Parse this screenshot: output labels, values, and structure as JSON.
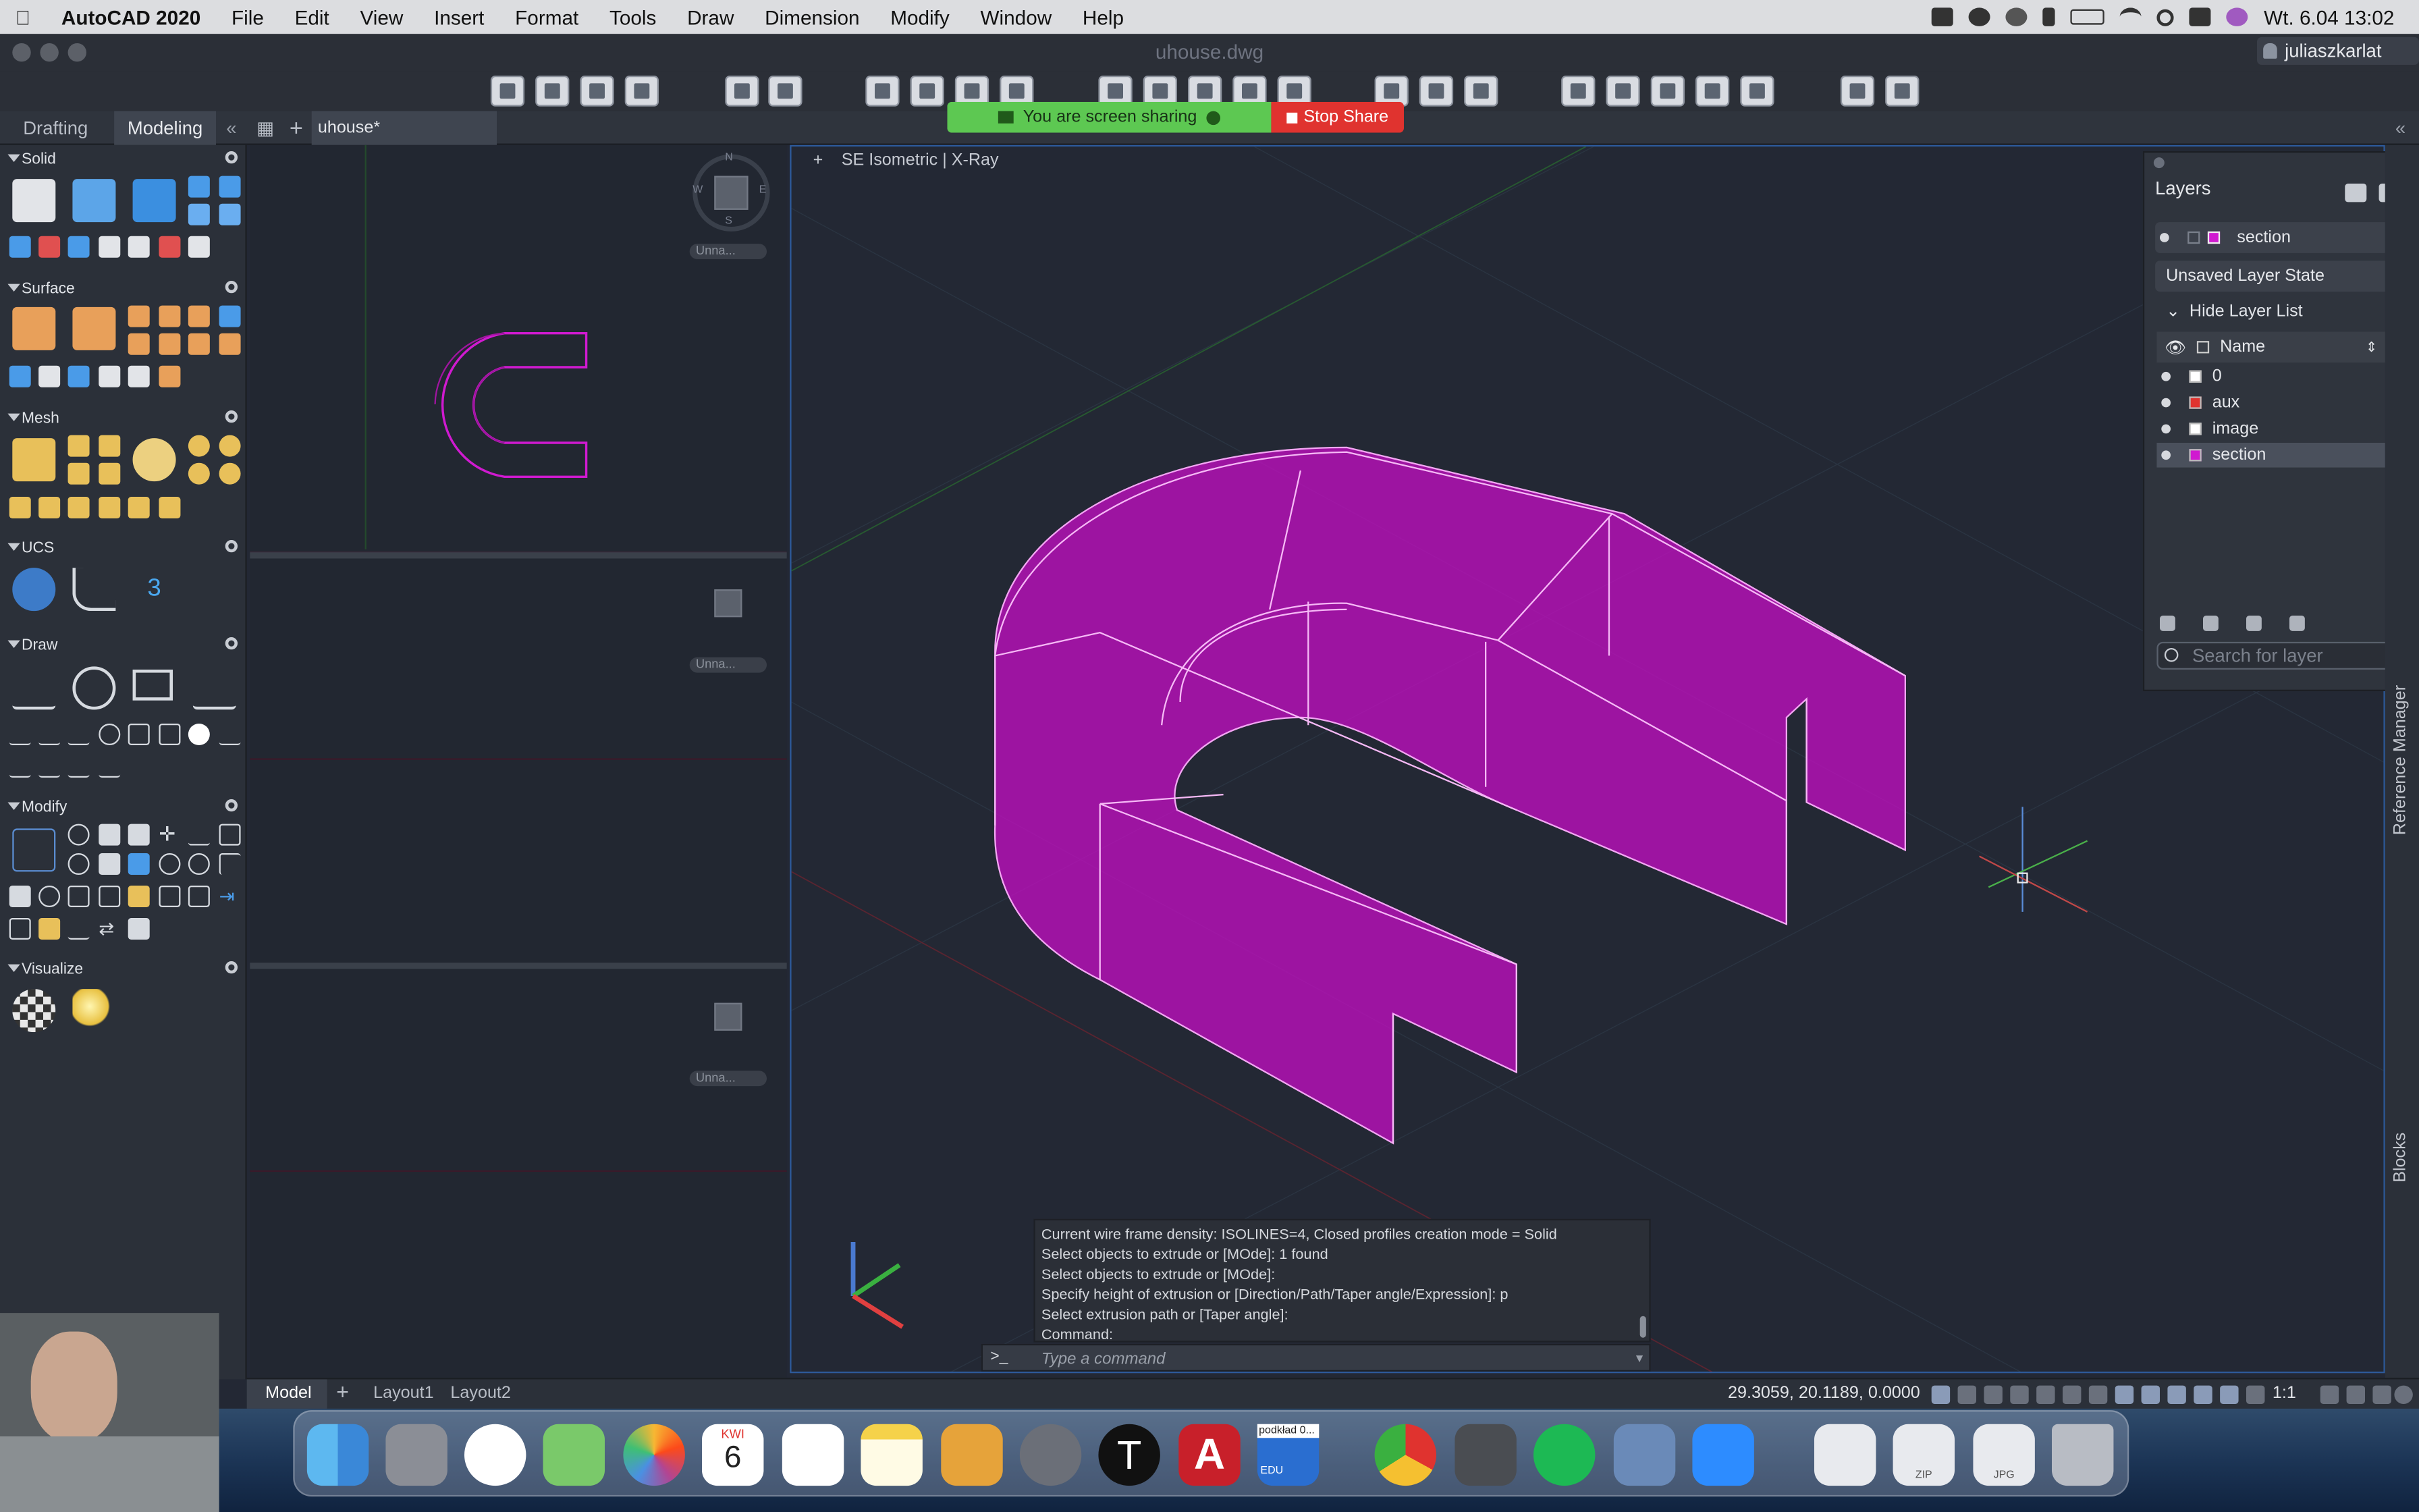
{
  "menubar": {
    "app_name": "AutoCAD 2020",
    "items": [
      "File",
      "Edit",
      "View",
      "Insert",
      "Format",
      "Tools",
      "Draw",
      "Dimension",
      "Modify",
      "Window",
      "Help"
    ],
    "clock": "Wt. 6.04  13:02"
  },
  "window": {
    "title": "uhouse.dwg",
    "user": "juliaszkarlat"
  },
  "share_banner": {
    "message": "You are screen sharing",
    "stop_label": "Stop Share"
  },
  "palette_tabs": {
    "drafting": "Drafting",
    "modeling": "Modeling"
  },
  "doc_tab": {
    "label": "uhouse*"
  },
  "tool_palette": {
    "sections": [
      "Solid",
      "Surface",
      "Mesh",
      "UCS",
      "Draw",
      "Modify",
      "Visualize"
    ]
  },
  "viewports": {
    "main_label": "SE Isometric | X-Ray",
    "compass": {
      "n": "N",
      "s": "S",
      "w": "W",
      "e": "E"
    },
    "small_label": "Unna..."
  },
  "ucs_badge": "3",
  "layers_panel": {
    "title": "Layers",
    "current_layer": "section",
    "layer_state": "Unsaved Layer State",
    "hide_list_label": "Hide Layer List",
    "column_name": "Name",
    "layers": [
      {
        "name": "0",
        "color": "#ffffff"
      },
      {
        "name": "aux",
        "color": "#e0332f"
      },
      {
        "name": "image",
        "color": "#ffffff"
      },
      {
        "name": "section",
        "color": "#d01ad0"
      }
    ],
    "search_placeholder": "Search for layer"
  },
  "command_line": {
    "history": [
      "Current wire frame density:  ISOLINES=4, Closed profiles creation mode = Solid",
      "Select objects to extrude or [MOde]: 1 found",
      "Select objects to extrude or [MOde]:",
      "Specify height of extrusion or [Direction/Path/Taper angle/Expression]: p",
      "Select extrusion path or [Taper angle]:",
      "Command:"
    ],
    "prompt_icon": ">_",
    "placeholder": "Type a command"
  },
  "status_bar": {
    "tabs": [
      "Model",
      "Layout1",
      "Layout2"
    ],
    "coords": "29.3059, 20.1189, 0.0000",
    "scale": "1:1"
  },
  "side_panels": {
    "reference": "Reference Manager",
    "blocks": "Blocks"
  },
  "dock": {
    "calendar_month": "KWI",
    "calendar_day": "6",
    "edu_label": "EDU",
    "podklad": "podkład 0...",
    "zip": "ZIP",
    "jpg": "JPG"
  },
  "colors": {
    "accent": "#2d5a9b",
    "solid": "#c010c0",
    "edge": "#f0a0f0"
  }
}
